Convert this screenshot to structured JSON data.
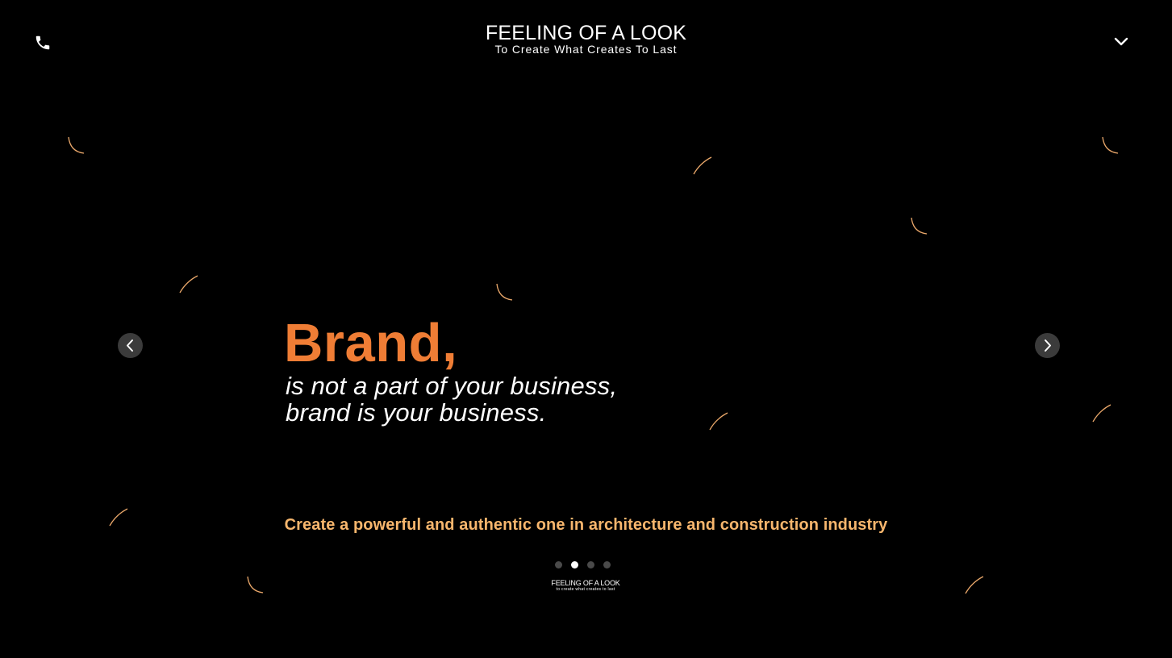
{
  "header": {
    "logo_title": "FEELING OF A LOOK",
    "logo_tagline": "To Create What Creates To Last",
    "phone_icon": "phone-icon",
    "menu_icon": "chevron-down-icon"
  },
  "slider": {
    "headline": "Brand,",
    "subline_1": "is not a part of your business,",
    "subline_2": "brand is your business.",
    "tagline": "Create a powerful and authentic one in architecture and construction industry",
    "prev_icon": "chevron-left-icon",
    "next_icon": "chevron-right-icon",
    "slide_count": 4,
    "active_slide": 2
  },
  "footer_logo": {
    "title": "FEELING OF A LOOK",
    "tagline": "to create what creates to last"
  },
  "colors": {
    "background": "#000000",
    "accent": "#ef7d35",
    "tagline": "#f7b66d",
    "text": "#ffffff",
    "arc": "#e9a76a"
  }
}
